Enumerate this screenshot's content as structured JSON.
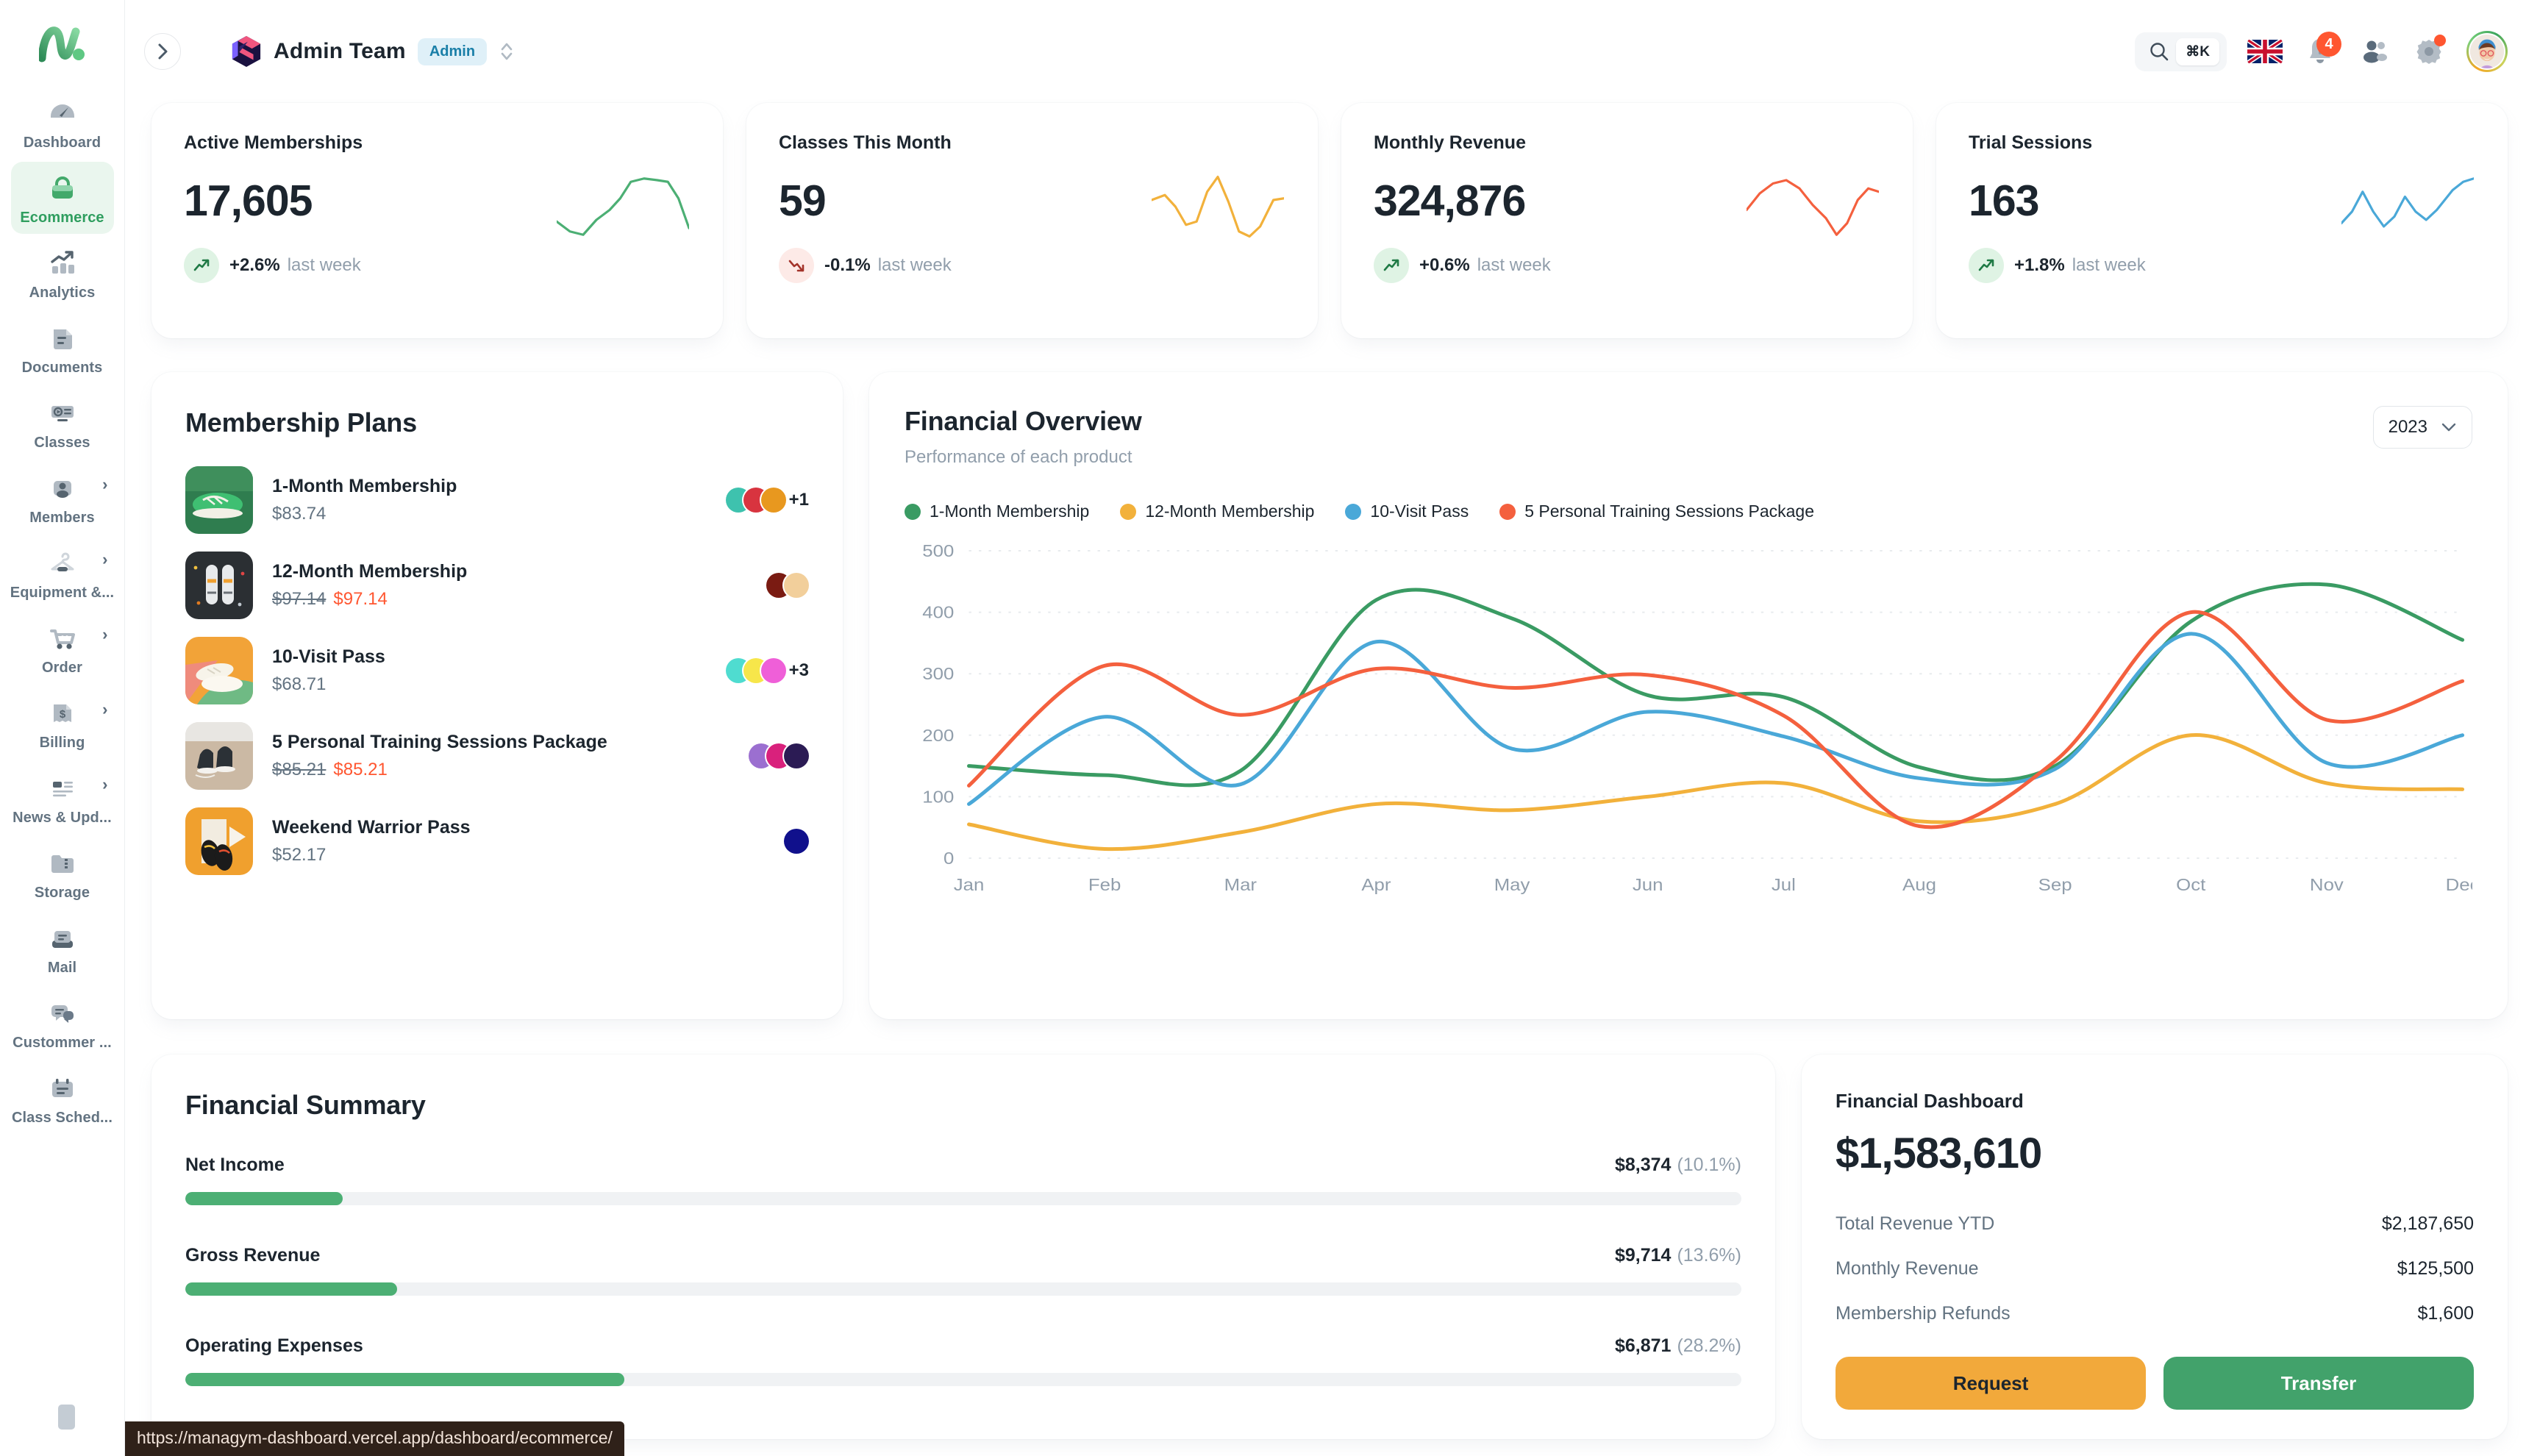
{
  "brand": {
    "logo_name": "managym-logo"
  },
  "sidebar": {
    "items": [
      {
        "label": "Dashboard",
        "icon": "gauge-icon",
        "active": false,
        "expandable": false
      },
      {
        "label": "Ecommerce",
        "icon": "shopping-bag-icon",
        "active": true,
        "expandable": false
      },
      {
        "label": "Analytics",
        "icon": "bar-chart-icon",
        "active": false,
        "expandable": false
      },
      {
        "label": "Documents",
        "icon": "document-icon",
        "active": false,
        "expandable": false
      },
      {
        "label": "Classes",
        "icon": "video-list-icon",
        "active": false,
        "expandable": false
      },
      {
        "label": "Members",
        "icon": "user-icon",
        "active": false,
        "expandable": true
      },
      {
        "label": "Equipment &...",
        "icon": "hanger-icon",
        "active": false,
        "expandable": true
      },
      {
        "label": "Order",
        "icon": "shopping-cart-icon",
        "active": false,
        "expandable": true
      },
      {
        "label": "Billing",
        "icon": "receipt-dollar-icon",
        "active": false,
        "expandable": true
      },
      {
        "label": "News & Upd...",
        "icon": "news-icon",
        "active": false,
        "expandable": true
      },
      {
        "label": "Storage",
        "icon": "folder-zip-icon",
        "active": false,
        "expandable": false
      },
      {
        "label": "Mail",
        "icon": "mail-icon",
        "active": false,
        "expandable": false
      },
      {
        "label": "Custommer ...",
        "icon": "chat-icon",
        "active": false,
        "expandable": false
      },
      {
        "label": "Class Sched...",
        "icon": "calendar-icon",
        "active": false,
        "expandable": false
      }
    ]
  },
  "topbar": {
    "collapse_icon": "chevron-right-icon",
    "workspace_name": "Admin Team",
    "workspace_badge": "Admin",
    "search": {
      "icon": "search-icon",
      "shortcut": "⌘K"
    },
    "language_flag": "uk-flag-icon",
    "notifications": {
      "icon": "bell-icon",
      "count": "4"
    },
    "contacts_icon": "contacts-icon",
    "settings": {
      "icon": "gear-icon",
      "has_dot": true
    },
    "avatar_icon": "user-avatar"
  },
  "kpis": [
    {
      "title": "Active Memberships",
      "value": "17,605",
      "pct": "+2.6%",
      "sub": "last week",
      "direction": "up",
      "color": "#4caf74"
    },
    {
      "title": "Classes This Month",
      "value": "59",
      "pct": "-0.1%",
      "sub": "last week",
      "direction": "down",
      "color": "#f2b13b"
    },
    {
      "title": "Monthly Revenue",
      "value": "324,876",
      "pct": "+0.6%",
      "sub": "last week",
      "direction": "up",
      "color": "#f4603e"
    },
    {
      "title": "Trial Sessions",
      "value": "163",
      "pct": "+1.8%",
      "sub": "last week",
      "direction": "up",
      "color": "#4aa8d8"
    }
  ],
  "plans": {
    "title": "Membership Plans",
    "items": [
      {
        "name": "1-Month Membership",
        "price": "$83.74",
        "old_price": "",
        "thumb": "green-sneakers",
        "avatars": [
          "#3ec2ae",
          "#d8343f",
          "#e8981f"
        ],
        "more": "+1"
      },
      {
        "name": "12-Month Membership",
        "price": "$97.14",
        "old_price": "$97.14",
        "thumb": "dark-sneakers",
        "avatars": [
          "#7a1b12",
          "#f2cf9b"
        ],
        "more": ""
      },
      {
        "name": "10-Visit Pass",
        "price": "$68.71",
        "old_price": "",
        "thumb": "white-sneakers",
        "avatars": [
          "#4fdcd0",
          "#f7e64a",
          "#ef5fd8"
        ],
        "more": "+3"
      },
      {
        "name": "5 Personal Training Sessions Package",
        "price": "$85.21",
        "old_price": "$85.21",
        "thumb": "converse-sneakers",
        "avatars": [
          "#9b6fd0",
          "#d9217c",
          "#2b1b54"
        ],
        "more": ""
      },
      {
        "name": "Weekend Warrior Pass",
        "price": "$52.17",
        "old_price": "",
        "thumb": "orange-sneakers",
        "avatars": [
          "#10108c"
        ],
        "more": ""
      }
    ]
  },
  "financial_overview": {
    "title": "Financial Overview",
    "subtitle": "Performance of each product",
    "year": "2023",
    "year_caret": "chevron-down-icon"
  },
  "chart_data": {
    "type": "line",
    "title": "Financial Overview",
    "subtitle": "Performance of each product",
    "xlabel": "",
    "ylabel": "",
    "ylim": [
      0,
      500
    ],
    "yticks": [
      0,
      100,
      200,
      300,
      400,
      500
    ],
    "grid": true,
    "legend_position": "top-left",
    "categories": [
      "Jan",
      "Feb",
      "Mar",
      "Apr",
      "May",
      "Jun",
      "Jul",
      "Aug",
      "Sep",
      "Oct",
      "Nov",
      "Dec"
    ],
    "series": [
      {
        "name": "1-Month Membership",
        "color": "#3a9b63",
        "values": [
          150,
          135,
          142,
          420,
          390,
          265,
          262,
          148,
          150,
          385,
          445,
          355
        ]
      },
      {
        "name": "12-Month Membership",
        "color": "#f2b13b",
        "values": [
          55,
          15,
          42,
          88,
          78,
          100,
          122,
          60,
          88,
          200,
          122,
          112
        ]
      },
      {
        "name": "10-Visit Pass",
        "color": "#4aa8d8",
        "values": [
          88,
          230,
          120,
          352,
          178,
          238,
          198,
          130,
          145,
          365,
          155,
          200
        ]
      },
      {
        "name": "5 Personal Training Sessions Package",
        "color": "#f4603e",
        "values": [
          118,
          313,
          233,
          308,
          277,
          298,
          232,
          52,
          158,
          400,
          225,
          288
        ]
      }
    ]
  },
  "financial_summary": {
    "title": "Financial Summary",
    "items": [
      {
        "label": "Net Income",
        "value": "$8,374",
        "pct": "(10.1%)",
        "fill": 10.1
      },
      {
        "label": "Gross Revenue",
        "value": "$9,714",
        "pct": "(13.6%)",
        "fill": 13.6
      },
      {
        "label": "Operating Expenses",
        "value": "$6,871",
        "pct": "(28.2%)",
        "fill": 28.2
      }
    ]
  },
  "financial_dashboard": {
    "title": "Financial Dashboard",
    "total": "$1,583,610",
    "rows": [
      {
        "key": "Total Revenue YTD",
        "value": "$2,187,650"
      },
      {
        "key": "Monthly Revenue",
        "value": "$125,500"
      },
      {
        "key": "Membership Refunds",
        "value": "$1,600"
      }
    ],
    "request_label": "Request",
    "transfer_label": "Transfer"
  },
  "status_bar": {
    "url": "https://managym-dashboard.vercel.app/dashboard/ecommerce/"
  }
}
